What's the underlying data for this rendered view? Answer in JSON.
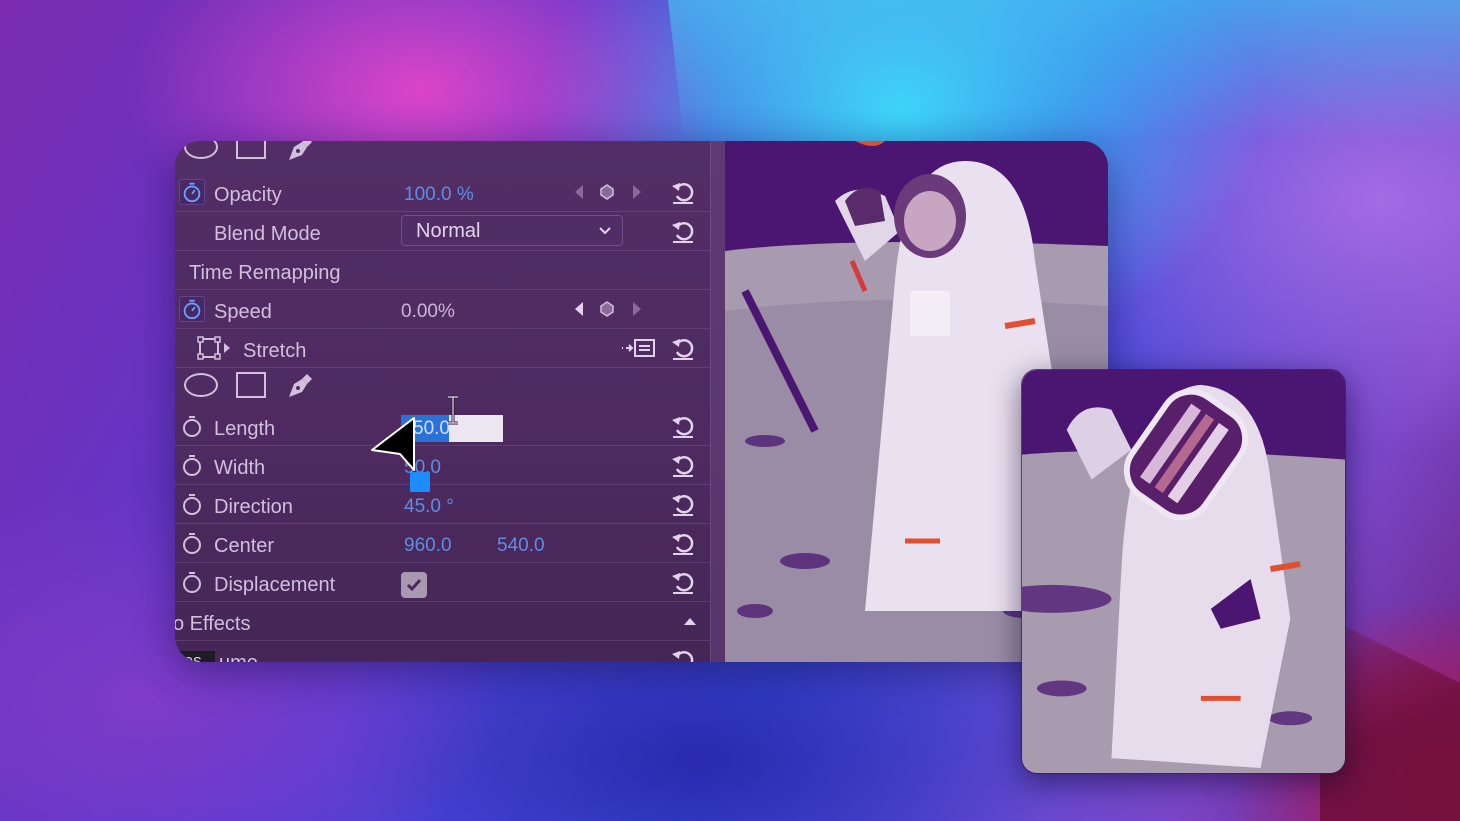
{
  "panel": {
    "rows": {
      "opacity": {
        "label": "Opacity",
        "value": "100.0 %"
      },
      "blend_mode": {
        "label": "Blend Mode",
        "value": "Normal"
      },
      "time_remapping": {
        "label": "Time Remapping"
      },
      "speed": {
        "label": "Speed",
        "value": "0.00%"
      },
      "stretch": {
        "label": "Stretch"
      },
      "length": {
        "label": "Length",
        "value": "50.0",
        "selected_text": "50.0"
      },
      "width": {
        "label": "Width",
        "value": "50.0"
      },
      "direction": {
        "label": "Direction",
        "value": "45.0 °"
      },
      "center": {
        "label": "Center",
        "x": "960.0",
        "y": "540.0"
      },
      "displacement": {
        "label": "Displacement",
        "checked": true
      },
      "video_effects": {
        "label": "o Effects"
      },
      "volume": {
        "label": "ume",
        "tooltip": "tos"
      }
    }
  },
  "icons": {
    "stopwatch": "stopwatch-icon",
    "reset": "reset-icon",
    "keyframe_prev": "triangle-left-icon",
    "keyframe_add": "diamond-icon",
    "keyframe_next": "triangle-right-icon",
    "ellipse_tool": "ellipse-mask-icon",
    "rect_tool": "rectangle-mask-icon",
    "pen_tool": "pen-mask-icon"
  },
  "colors": {
    "value_blue": "#5e8ee0",
    "selection_blue": "#2a72d8",
    "handle_blue": "#1e8cff",
    "panel_bg": "#532e66"
  }
}
